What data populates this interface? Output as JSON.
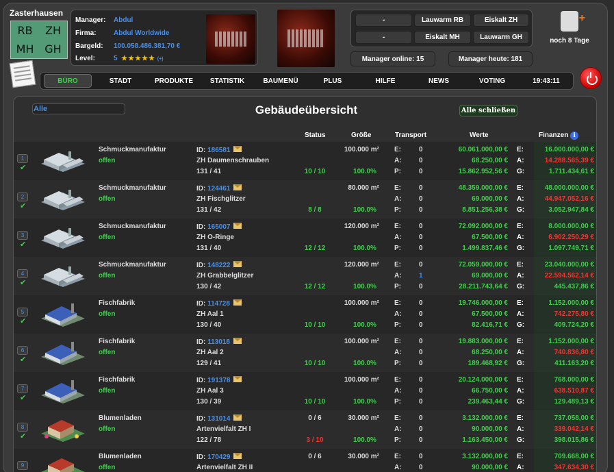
{
  "city": {
    "name": "Zasterhausen",
    "map_labels": [
      "RB",
      "ZH",
      "MH",
      "GH"
    ]
  },
  "manager_info": {
    "rows": [
      {
        "label": "Manager:",
        "value": "Abdul"
      },
      {
        "label": "Firma:",
        "value": "Abdul Worldwide"
      },
      {
        "label": "Bargeld:",
        "value": "100.058.486.381,70 €"
      },
      {
        "label": "Level:",
        "value": "5"
      }
    ],
    "stars": "★★★★★",
    "level_extra": "(+)"
  },
  "price_buttons": [
    "-",
    "Lauwarm RB",
    "Eiskalt ZH",
    "-",
    "Eiskalt MH",
    "Lauwarm GH"
  ],
  "stats": {
    "online": "Manager online:  15",
    "today": "Manager heute:  181"
  },
  "notification": {
    "text": "noch 8 Tage",
    "icon": "premium-icon"
  },
  "nav": {
    "items": [
      "BÜRO",
      "STADT",
      "PRODUKTE",
      "STATISTIK",
      "BAUMENÜ",
      "PLUS",
      "HILFE",
      "NEWS",
      "VOTING"
    ],
    "active": "BÜRO",
    "clock": "19:43:11"
  },
  "panel": {
    "filter_value": "Alle",
    "title": "Gebäudeübersicht",
    "close_all": "Alle schließen",
    "columns": [
      "Status",
      "Größe",
      "Transport",
      "Werte",
      "Finanzen"
    ]
  },
  "colors": {
    "green": "#3ed14b",
    "red": "#ff3030",
    "blue": "#4a8fe8"
  },
  "buildings": [
    {
      "num": "1",
      "type": "Schmuckmanufaktur",
      "status_word": "offen",
      "id": "186581",
      "name": "ZH Daumenschrauben",
      "capacity": "131 / 41",
      "status": "10 / 10",
      "status_color": "green",
      "size": "100.000 m²",
      "pct": "100.0%",
      "E": "0",
      "A": "0",
      "P": "0",
      "w1": "60.061.000,00 €",
      "w2": "68.250,00 €",
      "w3": "15.862.952,56 €",
      "f1": "16.000.000,00 €",
      "f2": "14.288.565,39 €",
      "f3": "1.711.434,61 €",
      "icon": "factory-icon"
    },
    {
      "num": "2",
      "type": "Schmuckmanufaktur",
      "status_word": "offen",
      "id": "124461",
      "name": "ZH Fischglitzer",
      "capacity": "131 / 42",
      "status": "8 / 8",
      "status_color": "green",
      "size": "80.000 m²",
      "pct": "100.0%",
      "E": "0",
      "A": "0",
      "P": "0",
      "w1": "48.359.000,00 €",
      "w2": "69.000,00 €",
      "w3": "8.851.256,38 €",
      "f1": "48.000.000,00 €",
      "f2": "44.947.052,16 €",
      "f3": "3.052.947,84 €",
      "icon": "factory-icon"
    },
    {
      "num": "3",
      "type": "Schmuckmanufaktur",
      "status_word": "offen",
      "id": "165007",
      "name": "ZH O-Ringe",
      "capacity": "131 / 40",
      "status": "12 / 12",
      "status_color": "green",
      "size": "120.000 m²",
      "pct": "100.0%",
      "E": "0",
      "A": "0",
      "P": "0",
      "w1": "72.092.000,00 €",
      "w2": "67.500,00 €",
      "w3": "1.499.837,46 €",
      "f1": "8.000.000,00 €",
      "f2": "6.902.250,29 €",
      "f3": "1.097.749,71 €",
      "icon": "factory-icon"
    },
    {
      "num": "4",
      "type": "Schmuckmanufaktur",
      "status_word": "offen",
      "id": "148222",
      "name": "ZH Grabbelglitzer",
      "capacity": "130 / 42",
      "status": "12 / 12",
      "status_color": "green",
      "size": "120.000 m²",
      "pct": "100.0%",
      "E": "0",
      "A": "1",
      "P": "0",
      "w1": "72.059.000,00 €",
      "w2": "69.000,00 €",
      "w3": "28.211.743,64 €",
      "f1": "23.040.000,00 €",
      "f2": "22.594.562,14 €",
      "f3": "445.437,86 €",
      "icon": "factory-icon"
    },
    {
      "num": "5",
      "type": "Fischfabrik",
      "status_word": "offen",
      "id": "114728",
      "name": "ZH Aal 1",
      "capacity": "130 / 40",
      "status": "10 / 10",
      "status_color": "green",
      "size": "100.000 m²",
      "pct": "100.0%",
      "E": "0",
      "A": "0",
      "P": "0",
      "w1": "19.746.000,00 €",
      "w2": "67.500,00 €",
      "w3": "82.416,71 €",
      "f1": "1.152.000,00 €",
      "f2": "742.275,80 €",
      "f3": "409.724,20 €",
      "icon": "fish-factory-icon"
    },
    {
      "num": "6",
      "type": "Fischfabrik",
      "status_word": "offen",
      "id": "113018",
      "name": "ZH Aal 2",
      "capacity": "129 / 41",
      "status": "10 / 10",
      "status_color": "green",
      "size": "100.000 m²",
      "pct": "100.0%",
      "E": "0",
      "A": "0",
      "P": "0",
      "w1": "19.883.000,00 €",
      "w2": "68.250,00 €",
      "w3": "189.468,92 €",
      "f1": "1.152.000,00 €",
      "f2": "740.836,80 €",
      "f3": "411.163,20 €",
      "icon": "fish-factory-icon"
    },
    {
      "num": "7",
      "type": "Fischfabrik",
      "status_word": "offen",
      "id": "191378",
      "name": "ZH Aal 3",
      "capacity": "130 / 39",
      "status": "10 / 10",
      "status_color": "green",
      "size": "100.000 m²",
      "pct": "100.0%",
      "E": "0",
      "A": "0",
      "P": "0",
      "w1": "20.124.000,00 €",
      "w2": "66.750,00 €",
      "w3": "239.463,44 €",
      "f1": "768.000,00 €",
      "f2": "638.510,87 €",
      "f3": "129.489,13 €",
      "icon": "fish-factory-icon"
    },
    {
      "num": "8",
      "type": "Blumenladen",
      "status_word": "offen",
      "id": "131014",
      "name": "Artenvielfalt ZH I",
      "capacity": "122 / 78",
      "status": "3 / 10",
      "status_color": "red",
      "status_top": "0 / 6",
      "size": "30.000 m²",
      "pct": "100.0%",
      "E": "0",
      "A": "0",
      "P": "0",
      "w1": "3.132.000,00 €",
      "w2": "90.000,00 €",
      "w3": "1.163.450,00 €",
      "f1": "737.058,00 €",
      "f2": "339.042,14 €",
      "f3": "398.015,86 €",
      "icon": "flower-shop-icon"
    },
    {
      "num": "9",
      "type": "Blumenladen",
      "status_word": "offen",
      "id": "170429",
      "name": "Artenvielfalt ZH II",
      "capacity": "",
      "status": "",
      "status_color": "green",
      "status_top": "0 / 6",
      "size": "30.000 m²",
      "pct": "",
      "E": "0",
      "A": "0",
      "P": "",
      "w1": "3.132.000,00 €",
      "w2": "90.000,00 €",
      "w3": "",
      "f1": "709.668,00 €",
      "f2": "347.634,30 €",
      "f3": "",
      "icon": "flower-shop-icon"
    }
  ]
}
